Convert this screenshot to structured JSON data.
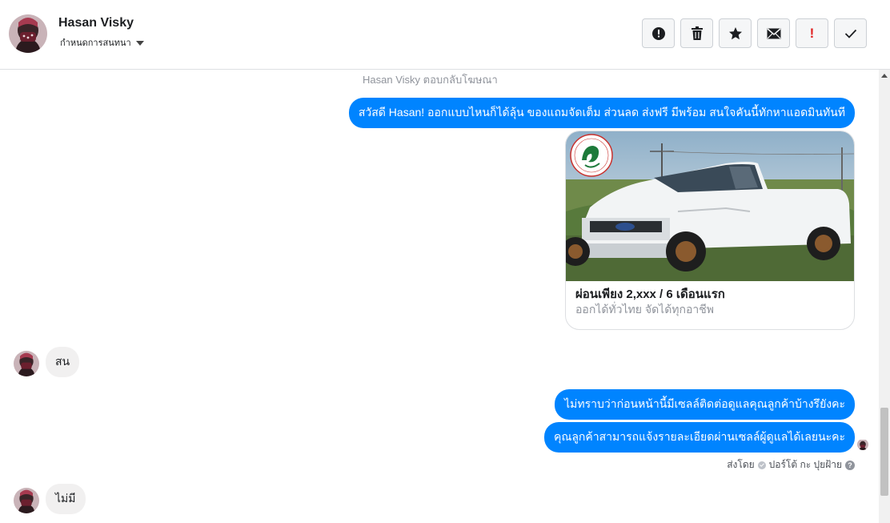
{
  "header": {
    "name": "Hasan Visky",
    "subtitle": "กำหนดการสนทนา",
    "tools": [
      "alert-icon",
      "trash-icon",
      "star-icon",
      "envelope-icon",
      "important-icon",
      "check-icon"
    ],
    "important_mark": "!"
  },
  "conversation": {
    "reply_note": "Hasan Visky ตอบกลับโฆษณา",
    "greeting": "สวัสดี Hasan! ออกแบบไหนก็ได้ลุ้น ของแถมจัดเต็ม ส่วนลด ส่งฟรี มีพร้อม สนใจคันนี้ทักหาแอดมินทันที",
    "card": {
      "title": "ผ่อนเพียง 2,xxx / 6 เดือนแรก",
      "subtitle": "ออกได้ทั่วไทย จัดได้ทุกอาชีพ"
    },
    "incoming_1": "สน",
    "outgoing_1": "ไม่ทราบว่าก่อนหน้านี้มีเซลล์ติดต่อดูแลคุณลูกค้าบ้างรึยังคะ",
    "outgoing_2": "คุณลูกค้าสามารถแจ้งรายละเอียดผ่านเซลล์ผู้ดูแลได้เลยนะคะ",
    "sent_by": "ส่งโดย",
    "sender": "ปอร์โต้ กะ ปุยฝ้าย",
    "help_mark": "?",
    "incoming_2": "ไม่มี"
  },
  "colors": {
    "accent": "#0084ff",
    "incoming_bubble": "#f1f0f0",
    "muted_text": "#90949c",
    "important": "#e02020"
  }
}
